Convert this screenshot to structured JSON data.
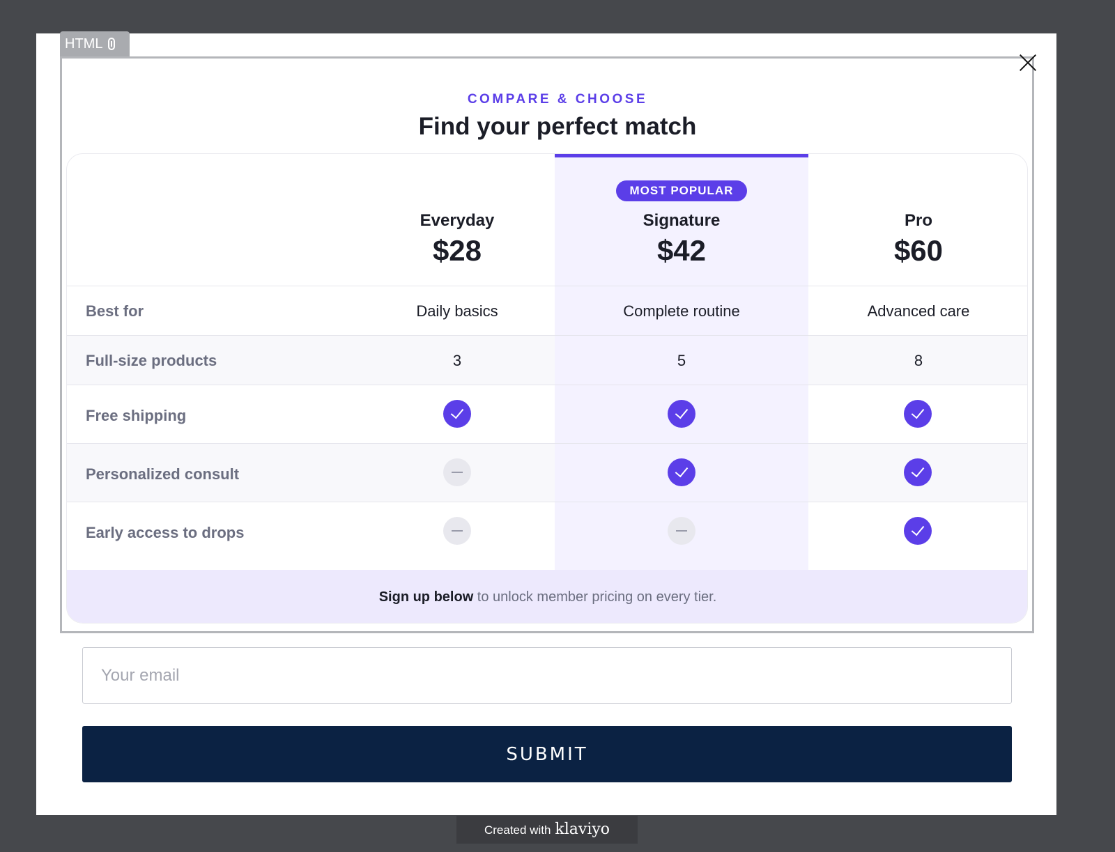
{
  "editor": {
    "block_tag": "HTML"
  },
  "header": {
    "eyebrow": "COMPARE & CHOOSE",
    "title": "Find your perfect match"
  },
  "plans": [
    {
      "name": "Everyday",
      "price": "$28"
    },
    {
      "name": "Signature",
      "price": "$42",
      "badge": "MOST POPULAR"
    },
    {
      "name": "Pro",
      "price": "$60"
    }
  ],
  "features": [
    {
      "label": "Best for",
      "values": [
        "Daily basics",
        "Complete routine",
        "Advanced care"
      ]
    },
    {
      "label": "Full-size products",
      "values": [
        "3",
        "5",
        "8"
      ]
    },
    {
      "label": "Free shipping",
      "included": [
        true,
        true,
        true
      ]
    },
    {
      "label": "Personalized consult",
      "included": [
        false,
        true,
        true
      ]
    },
    {
      "label": "Early access to drops",
      "included": [
        false,
        false,
        true
      ]
    }
  ],
  "signup_note": {
    "bold": "Sign up below",
    "rest": " to unlock member pricing on every tier."
  },
  "form": {
    "email_placeholder": "Your email",
    "submit_label": "SUBMIT"
  },
  "footer": {
    "created_with": "Created with",
    "brand": "klaviyo"
  },
  "colors": {
    "accent": "#5b3ee8",
    "submit_bg": "#0b2243",
    "highlight_col": "#f4f2ff"
  }
}
